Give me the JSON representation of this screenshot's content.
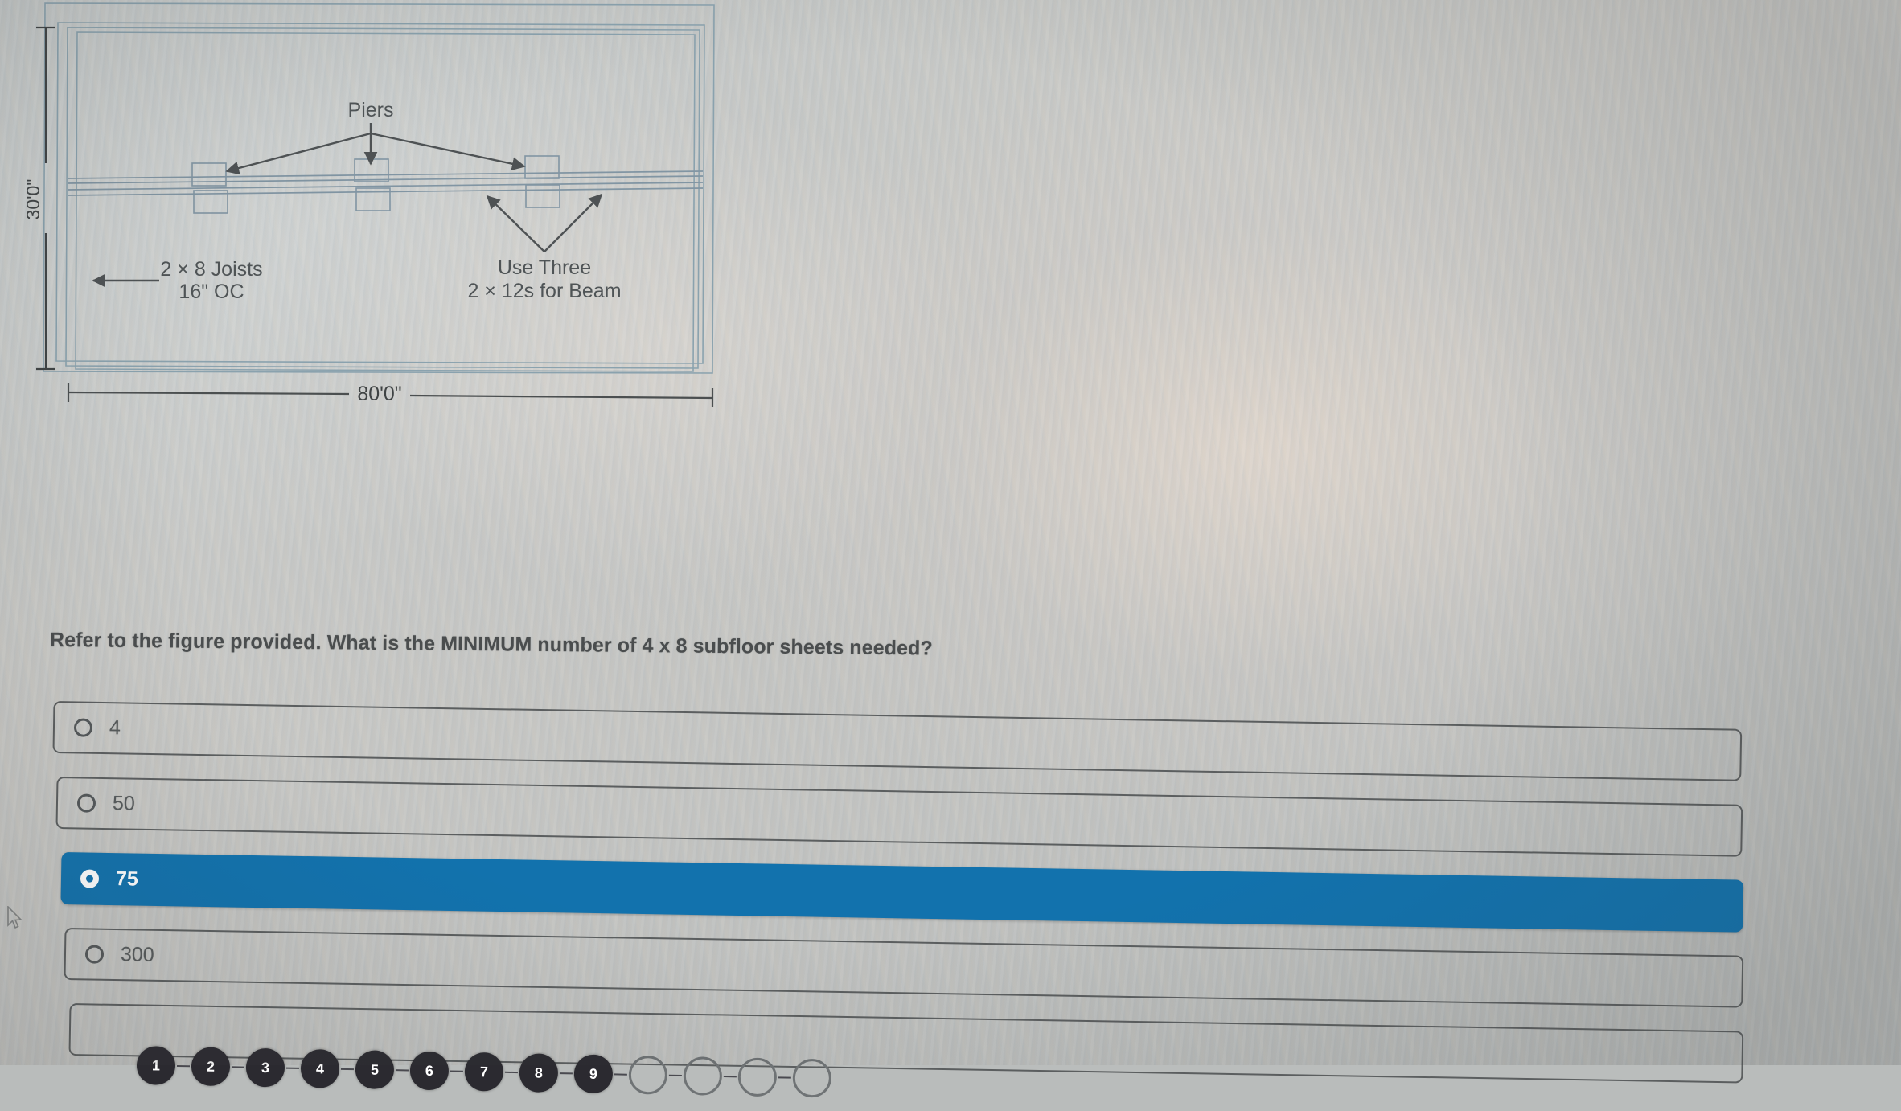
{
  "figure": {
    "title": "floor-framing-plan",
    "labels": {
      "piers": "Piers",
      "joists_line1": "2 × 8 Joists",
      "joists_line2": "16\" OC",
      "beam_line1": "Use Three",
      "beam_line2": "2 × 12s for Beam",
      "width_dimension": "80'0\"",
      "height_dimension": "30'0\""
    }
  },
  "question": {
    "prompt": "Refer to the figure provided. What is the MINIMUM number of 4 x 8 subfloor sheets needed?"
  },
  "options": [
    {
      "id": "opt-1",
      "label": "4",
      "selected": false
    },
    {
      "id": "opt-2",
      "label": "50",
      "selected": false
    },
    {
      "id": "opt-3",
      "label": "75",
      "selected": true
    },
    {
      "id": "opt-4",
      "label": "300",
      "selected": false
    }
  ],
  "question_nav": {
    "answered": [
      "1",
      "2",
      "3",
      "4",
      "5",
      "6",
      "7",
      "8",
      "9"
    ],
    "unanswered_count": 4
  },
  "colors": {
    "selected_blue": "#1272ad",
    "text_gray": "#565a5b",
    "border_gray": "#5b5e5f",
    "figure_line_blue": "#7f99a8",
    "figure_line_dark": "#55585a",
    "page_background": "#c3c7c6"
  }
}
